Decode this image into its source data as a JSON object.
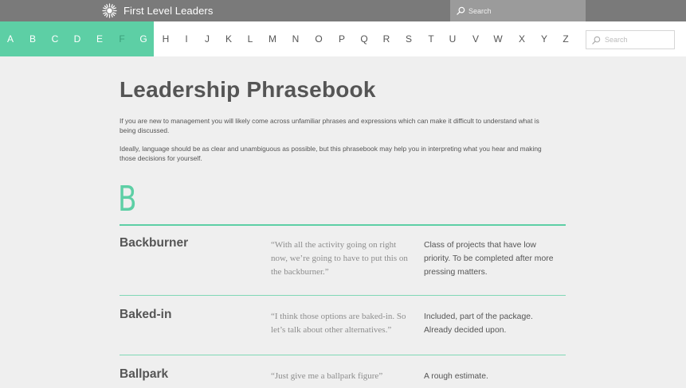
{
  "header": {
    "brand_name": "First Level Leaders",
    "search_placeholder": "Search"
  },
  "alphabet": {
    "letters": [
      "A",
      "B",
      "C",
      "D",
      "E",
      "F",
      "G",
      "H",
      "I",
      "J",
      "K",
      "L",
      "M",
      "N",
      "O",
      "P",
      "Q",
      "R",
      "S",
      "T",
      "U",
      "V",
      "W",
      "X",
      "Y",
      "Z"
    ],
    "active_letter": "F",
    "search_placeholder": "Search"
  },
  "page": {
    "title": "Leadership Phrasebook",
    "intro_1": "If you are new to management you will likely come across unfamiliar phrases and expressions which can make it difficult to understand what is being discussed.",
    "intro_2": "Ideally, language should be as clear and unambiguous as possible, but this phrasebook may help you in interpreting what you hear and making those decisions for yourself.",
    "section_letter": "B"
  },
  "entries": [
    {
      "term": "Backburner",
      "example": "“With all the activity going on right now, we’re going to have to put this on the backburner.”",
      "meaning": "Class of projects that have low priority. To be completed after more pressing matters."
    },
    {
      "term": "Baked-in",
      "example": "“I think those options are baked-in. So let’s talk about  other alternatives.”",
      "meaning": "Included, part of the package. Already decided upon."
    },
    {
      "term": "Ballpark",
      "example": "“Just give me a ballpark figure”",
      "meaning": "A rough estimate."
    }
  ],
  "colors": {
    "accent": "#5dcfa5",
    "topbar": "#7a7a7a",
    "background": "#efefef"
  },
  "icons": {
    "brand": "sunburst-logo-icon",
    "search": "search-icon"
  }
}
